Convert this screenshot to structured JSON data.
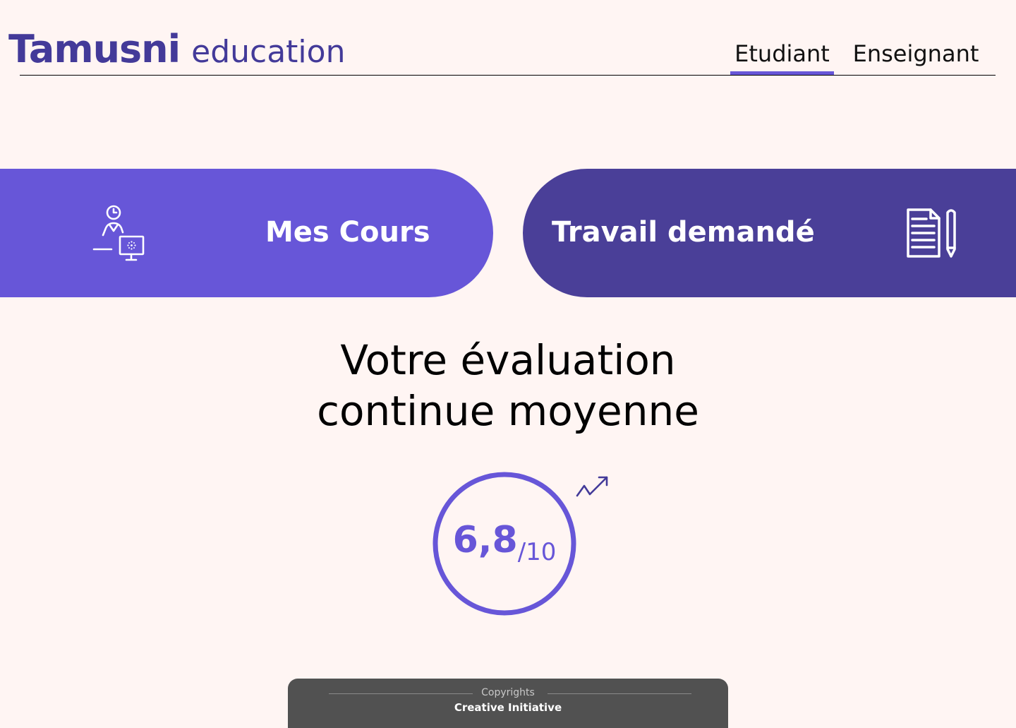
{
  "header": {
    "logo_main": "Tamusni",
    "logo_sub": "education",
    "tabs": [
      {
        "label": "Etudiant",
        "active": true
      },
      {
        "label": "Enseignant",
        "active": false
      }
    ]
  },
  "actions": {
    "courses": {
      "label": "Mes Cours",
      "icon": "teacher-computer-icon"
    },
    "work": {
      "label": "Travail demandé",
      "icon": "document-pencil-icon"
    }
  },
  "evaluation": {
    "title_line1": "Votre évaluation",
    "title_line2": "continue moyenne",
    "score": "6,8",
    "max": "/10",
    "trend_icon": "trend-up-icon"
  },
  "footer": {
    "caption": "Copyrights",
    "brand": "Creative Initiative"
  },
  "colors": {
    "background": "#fff5f3",
    "accent": "#6756d8",
    "accent_dark": "#4a3f98",
    "brand": "#433a99",
    "footer": "#515151"
  }
}
